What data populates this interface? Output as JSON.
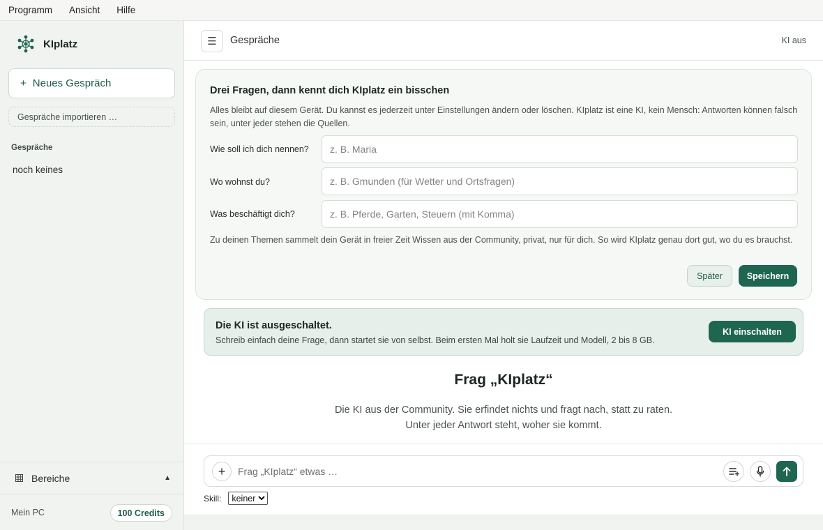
{
  "menubar": {
    "items": [
      "Programm",
      "Ansicht",
      "Hilfe"
    ]
  },
  "sidebar": {
    "app_name": "KIplatz",
    "logo_icon": "network-logo-icon",
    "new_chat_plus": "+",
    "new_chat_label": "Neues Gespräch",
    "import_label": "Gespräche importieren …",
    "section_label": "Gespräche",
    "empty_label": "noch keines",
    "areas_label": "Bereiche",
    "areas_caret": "▲",
    "device_label": "Mein PC",
    "credits_label": "100 Credits"
  },
  "header": {
    "menu_icon": "☰",
    "title": "Gespräche",
    "ki_status": "KI aus"
  },
  "onboarding": {
    "title": "Drei Fragen, dann kennt dich KIplatz ein bisschen",
    "intro": "Alles bleibt auf diesem Gerät. Du kannst es jederzeit unter Einstellungen ändern oder löschen. KIplatz ist eine KI, kein Mensch: Antworten können falsch sein, unter jeder stehen die Quellen.",
    "name_label": "Wie soll ich dich nennen?",
    "name_placeholder": "z. B. Maria",
    "name_value": "",
    "place_label": "Wo wohnst du?",
    "place_placeholder": "z. B. Gmunden (für Wetter und Ortsfragen)",
    "place_value": "",
    "topics_label": "Was beschäftigt dich?",
    "topics_placeholder": "z. B. Pferde, Garten, Steuern (mit Komma)",
    "topics_value": "",
    "hint": "Zu deinen Themen sammelt dein Gerät in freier Zeit Wissen aus der Community, privat, nur für dich. So wird KIplatz genau dort gut, wo du es brauchst.",
    "later_label": "Später",
    "save_label": "Speichern"
  },
  "banner": {
    "title": "Die KI ist ausgeschaltet.",
    "text": "Schreib einfach deine Frage, dann startet sie von selbst. Beim ersten Mal holt sie Laufzeit und Modell, 2 bis 8 GB.",
    "button_label": "KI einschalten"
  },
  "welcome": {
    "title": "Frag „KIplatz“",
    "line1": "Die KI aus der Community. Sie erfindet nichts und fragt nach, statt zu raten.",
    "line2": "Unter jeder Antwort steht, woher sie kommt."
  },
  "composer": {
    "attach_label": "+",
    "placeholder": "Frag „KIplatz“ etwas …",
    "value": "",
    "skill_label": "Skill:",
    "skill_selected": "keiner",
    "icons": {
      "list": "playlist-add-icon",
      "mic": "microphone-icon",
      "send": "arrow-up-icon"
    }
  },
  "colors": {
    "accent": "#1f6650",
    "banner_bg": "#e6efea",
    "sidebar_bg": "#f1f3f1"
  }
}
